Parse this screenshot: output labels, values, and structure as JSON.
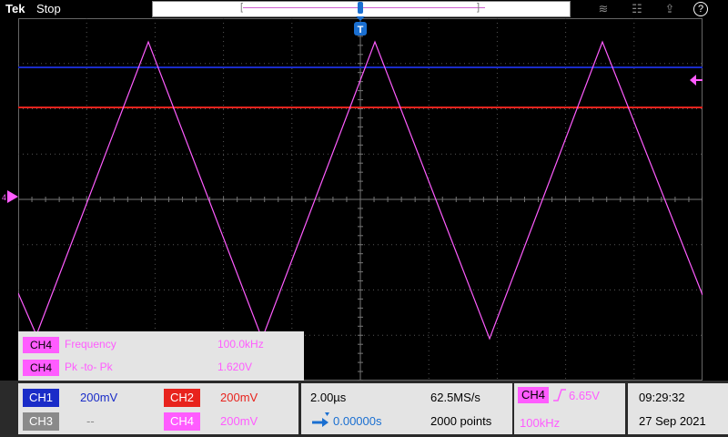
{
  "header": {
    "brand": "Tek",
    "status": "Stop",
    "help": "?"
  },
  "measurements": [
    {
      "channel": "CH4",
      "name": "Frequency",
      "value": "100.0kHz"
    },
    {
      "channel": "CH4",
      "name": "Pk -to- Pk",
      "value": "1.620V"
    }
  ],
  "channels": {
    "ch1": {
      "label": "CH1",
      "scale": "200mV"
    },
    "ch2": {
      "label": "CH2",
      "scale": "200mV"
    },
    "ch3": {
      "label": "CH3",
      "scale": "--"
    },
    "ch4": {
      "label": "CH4",
      "scale": "200mV"
    }
  },
  "horizontal": {
    "time_div": "2.00µs",
    "sample_rate": "62.5MS/s",
    "position": "0.00000s",
    "record_length": "2000 points"
  },
  "trigger": {
    "source": "CH4",
    "level": "6.65V",
    "frequency": "100kHz"
  },
  "clock": {
    "time": "09:29:32",
    "date": "27 Sep 2021"
  },
  "marker": {
    "ch4_ground_label": "4"
  },
  "colors": {
    "ch1": "#1a2cc8",
    "ch2": "#e8231d",
    "ch3": "#8a8a8a",
    "ch4": "#ff5cff",
    "trigger": "#1a6fd1"
  }
}
